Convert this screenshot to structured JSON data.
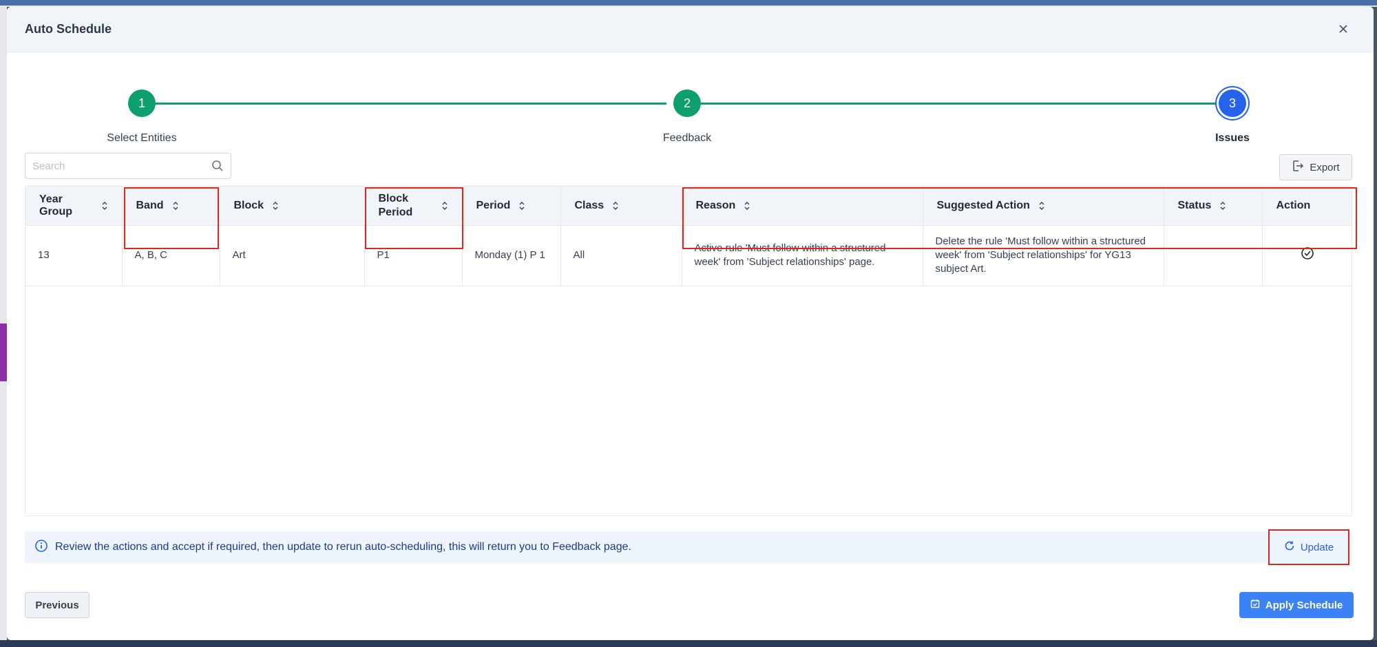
{
  "modal": {
    "title": "Auto Schedule"
  },
  "stepper": {
    "steps": [
      {
        "number": "1",
        "label": "Select Entities",
        "state": "complete"
      },
      {
        "number": "2",
        "label": "Feedback",
        "state": "complete"
      },
      {
        "number": "3",
        "label": "Issues",
        "state": "active"
      }
    ]
  },
  "toolbar": {
    "search_placeholder": "Search",
    "export_label": "Export"
  },
  "table": {
    "columns": [
      "Year Group",
      "Band",
      "Block",
      "Block Period",
      "Period",
      "Class",
      "Reason",
      "Suggested Action",
      "Status",
      "Action"
    ],
    "rows": [
      {
        "year_group": "13",
        "band": "A, B, C",
        "block": "Art",
        "block_period": "P1",
        "period": "Monday (1) P 1",
        "class": "All",
        "reason": "Active rule 'Must follow within a structured week' from 'Subject relationships' page.",
        "suggested_action": "Delete the rule 'Must follow within a structured week' from 'Subject relationships' for YG13 subject Art.",
        "status": ""
      }
    ]
  },
  "info": {
    "message": "Review the actions and accept if required, then update to rerun auto-scheduling, this will return you to Feedback page.",
    "update_label": "Update"
  },
  "footer": {
    "previous_label": "Previous",
    "apply_label": "Apply Schedule"
  },
  "colors": {
    "step_complete": "#0e9f6e",
    "step_active": "#2563eb",
    "highlight": "#e0261b",
    "primary": "#3b82f6"
  }
}
